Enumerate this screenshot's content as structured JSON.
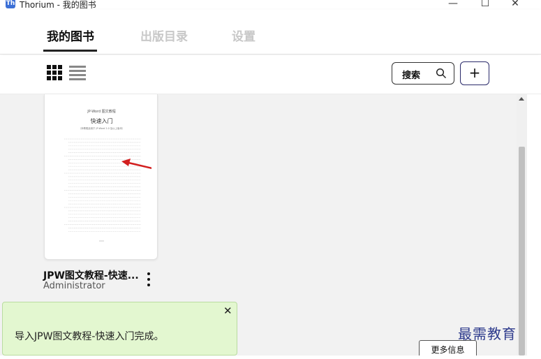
{
  "window": {
    "app_icon": "Th",
    "title": "Thorium - 我的图书",
    "controls": {
      "minimize": "—",
      "maximize": "☐",
      "close": "✕"
    }
  },
  "tabs": [
    {
      "label": "我的图书",
      "active": true
    },
    {
      "label": "出版目录",
      "active": false
    },
    {
      "label": "设置",
      "active": false
    }
  ],
  "toolbar": {
    "grid_view_icon": "grid-icon",
    "list_view_icon": "list-icon",
    "search_label": "搜索",
    "add_label": "+"
  },
  "book": {
    "title": "JPW图文教程-快速...",
    "author": "Administrator",
    "preview": {
      "header": "JP-Word 图文教程",
      "title": "快速入门",
      "subtitle": "（本教程适用于 JP-Word 2.0 及以上版本）"
    },
    "more_icon": "more-vertical-icon"
  },
  "toast": {
    "message": "导入JPW图文教程-快速入门完成。",
    "close": "✕"
  },
  "more_info_label": "更多信息",
  "watermark": "最需教育",
  "colors": {
    "toast_bg": "#e3f7d0",
    "accent": "#2a2a6a",
    "arrow": "#d21e1e"
  }
}
